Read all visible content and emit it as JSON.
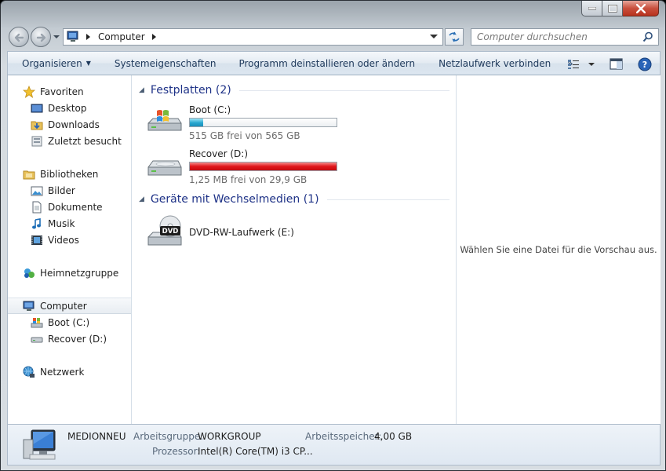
{
  "address": {
    "path": [
      "Computer"
    ]
  },
  "search": {
    "placeholder": "Computer durchsuchen"
  },
  "toolbar": {
    "organize": "Organisieren",
    "system_properties": "Systemeigenschaften",
    "uninstall": "Programm deinstallieren oder ändern",
    "map_network": "Netzlaufwerk verbinden",
    "more": "»"
  },
  "sidebar": {
    "favorites": {
      "label": "Favoriten",
      "items": [
        "Desktop",
        "Downloads",
        "Zuletzt besucht"
      ]
    },
    "libraries": {
      "label": "Bibliotheken",
      "items": [
        "Bilder",
        "Dokumente",
        "Musik",
        "Videos"
      ]
    },
    "homegroup": "Heimnetzgruppe",
    "computer": {
      "label": "Computer",
      "items": [
        "Boot (C:)",
        "Recover (D:)"
      ]
    },
    "network": "Netzwerk"
  },
  "groups": {
    "hard_disks": "Festplatten (2)",
    "removable": "Geräte mit Wechselmedien (1)"
  },
  "drives": [
    {
      "name": "Boot (C:)",
      "info": "515 GB frei von 565 GB",
      "used_fraction": 0.09,
      "color": "#27a6cf"
    },
    {
      "name": "Recover (D:)",
      "info": "1,25 MB frei von 29,9 GB",
      "used_fraction": 1.0,
      "color": "#e0151a"
    }
  ],
  "dvd": {
    "name": "DVD-RW-Laufwerk (E:)",
    "badge": "DVD"
  },
  "preview_text": "Wählen Sie eine Datei für die Vorschau aus.",
  "details": {
    "computer_name": "MEDIONNEU",
    "workgroup_label": "Arbeitsgruppe:",
    "workgroup": "WORKGROUP",
    "memory_label": "Arbeitsspeicher:",
    "memory": "4,00 GB",
    "cpu_label": "Prozessor:",
    "cpu": "Intel(R) Core(TM) i3 CP..."
  }
}
